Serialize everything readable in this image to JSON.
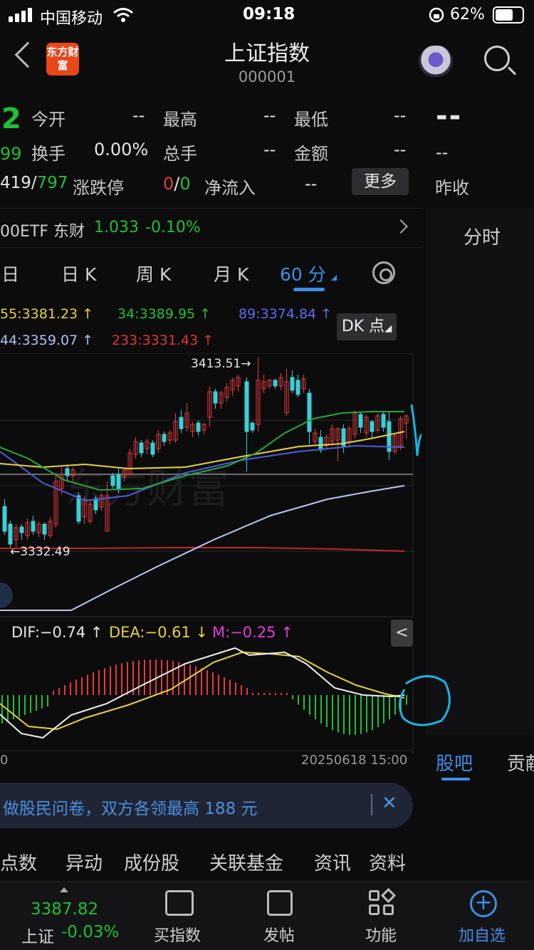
{
  "status": {
    "carrier": "中国移动",
    "time": "09:18",
    "battery": "62%"
  },
  "header": {
    "logo": "东方财富",
    "title": "上证指数",
    "code": "000001"
  },
  "quote": {
    "price_fragment": "2",
    "change_fragment": "99",
    "rows": [
      {
        "l1": "今开",
        "v1": "--",
        "l2": "最高",
        "v2": "--",
        "l3": "最低",
        "v3": "--"
      },
      {
        "l1": "换手",
        "v1": "0.00%",
        "l2": "总手",
        "v2": "--",
        "l3": "金额",
        "v3": "--"
      }
    ],
    "up_down": {
      "up": "419",
      "slash": "/",
      "down": "797"
    },
    "limit_label": "涨跌停",
    "limit_up": "0",
    "limit_slash": "/",
    "limit_down": "0",
    "netflow_label": "净流入",
    "netflow_value": "--",
    "more": "更多",
    "side": {
      "big": "--",
      "small": "--",
      "prev_close": "昨收"
    }
  },
  "etf": {
    "name": "00ETF 东财",
    "price": "1.033",
    "change": "-0.10%"
  },
  "side_tab": "分时",
  "tabs": [
    {
      "label": "日"
    },
    {
      "label": "日 K"
    },
    {
      "label": "周 K"
    },
    {
      "label": "月 K"
    },
    {
      "label": "60 分"
    }
  ],
  "ma": {
    "ma55": "55:3381.23 ↑",
    "ma34": "34:3389.95 ↑",
    "ma89": "89:3374.84 ↑",
    "ma144": "44:3359.07 ↑",
    "ma233": "233:3331.43 ↑"
  },
  "dk": "DK 点",
  "annotations": {
    "high": "3413.51→",
    "low": "←3332.49"
  },
  "macd": {
    "dif": "DIF:−0.74 ↑",
    "dea": "DEA:−0.61 ↓",
    "m": "M:−0.25 ↑",
    "collapse": "<"
  },
  "axis": {
    "left": "0",
    "right": "20250618 15:00"
  },
  "survey": {
    "text": "做股民问卷，双方各领最高 188 元",
    "close": "✕"
  },
  "bottom_tabs": [
    "点数",
    "异动",
    "成份股",
    "关联基金",
    "资讯",
    "资料"
  ],
  "side_bottom": {
    "active": "股吧",
    "other": "贡献"
  },
  "nav": {
    "index_value": "3387.82",
    "index_name": "上证",
    "index_change": "-0.03%",
    "items": [
      {
        "label": "买指数"
      },
      {
        "label": "发帖"
      },
      {
        "label": "功能"
      },
      {
        "label": "加自选"
      }
    ]
  },
  "colors": {
    "up": "#e83a3a",
    "down": "#1ec133",
    "accent": "#3d8fe6",
    "hand_drawn": "#16b6e6"
  }
}
